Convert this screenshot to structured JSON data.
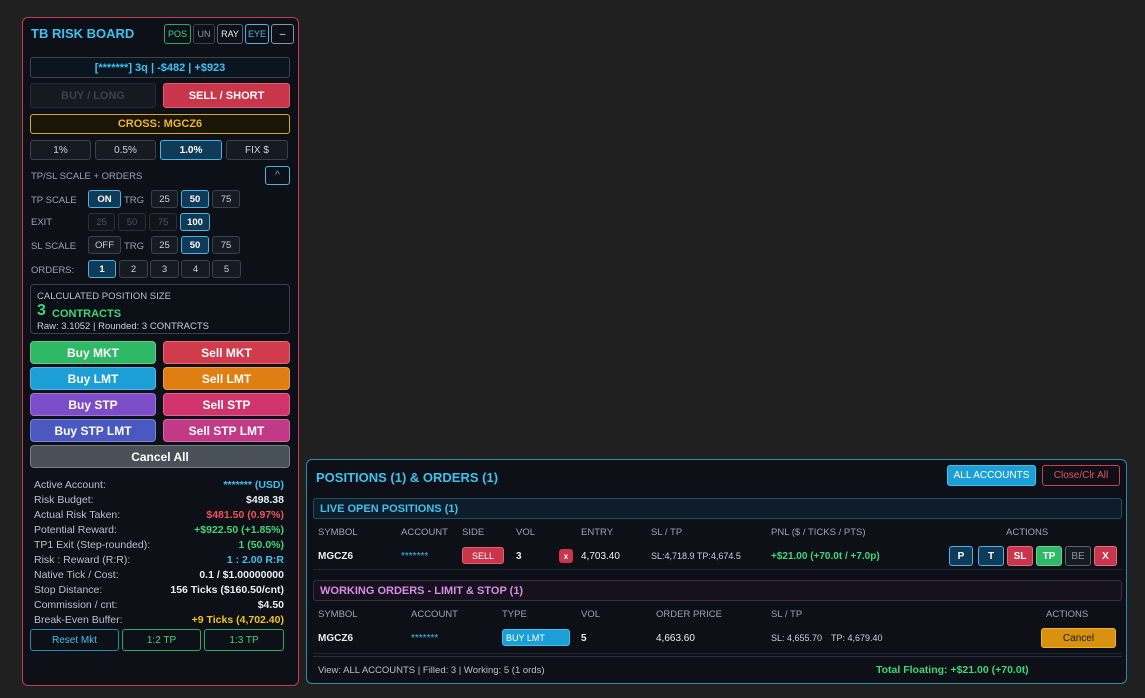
{
  "risk_board": {
    "title": "TB RISK BOARD",
    "toggles": [
      "POS",
      "UN",
      "RAY",
      "EYE",
      "–"
    ],
    "summary": "[*******] 3q | -$482 | +$923",
    "buy_long": "BUY / LONG",
    "sell_short": "SELL / SHORT",
    "cross": "CROSS: MGCZ6",
    "risk_options": [
      "1%",
      "0.5%",
      "1.0%",
      "FIX $"
    ],
    "scale_section": "TP/SL SCALE + ORDERS",
    "collapse": "^",
    "tp_scale": {
      "label": "TP SCALE",
      "state": "ON",
      "trg": "TRG",
      "values": [
        "25",
        "50",
        "75"
      ]
    },
    "exit": {
      "label": "EXIT",
      "values": [
        "25",
        "50",
        "75",
        "100"
      ]
    },
    "sl_scale": {
      "label": "SL SCALE",
      "state": "OFF",
      "trg": "TRG",
      "values": [
        "25",
        "50",
        "75"
      ]
    },
    "orders": {
      "label": "ORDERS:",
      "values": [
        "1",
        "2",
        "3",
        "4",
        "5"
      ]
    },
    "calc": {
      "title": "CALCULATED POSITION SIZE",
      "qty": "3",
      "unit": "CONTRACTS",
      "detail": "Raw: 3.1052 | Rounded: 3 CONTRACTS"
    },
    "buttons": {
      "buy_mkt": "Buy MKT",
      "sell_mkt": "Sell MKT",
      "buy_lmt": "Buy LMT",
      "sell_lmt": "Sell LMT",
      "buy_stp": "Buy STP",
      "sell_stp": "Sell STP",
      "buy_stp_lmt": "Buy STP LMT",
      "sell_stp_lmt": "Sell STP LMT",
      "cancel_all": "Cancel All"
    },
    "stats": [
      {
        "k": "Active Account:",
        "v": "******* (USD)",
        "c": "#3fc1f0"
      },
      {
        "k": "Risk Budget:",
        "v": "$498.38",
        "c": "#e6edf3"
      },
      {
        "k": "Actual Risk Taken:",
        "v": "$481.50 (0.97%)",
        "c": "#f0505a"
      },
      {
        "k": "Potential Reward:",
        "v": "+$922.50 (+1.85%)",
        "c": "#3fd67a"
      },
      {
        "k": "TP1 Exit (Step-rounded):",
        "v": "1 (50.0%)",
        "c": "#3fd67a"
      },
      {
        "k": "Risk : Reward (R:R):",
        "v": "1 : 2.00 R:R",
        "c": "#3fc1f0"
      },
      {
        "k": "Native Tick / Cost:",
        "v": "0.1 / $1.00000000",
        "c": "#e6edf3"
      },
      {
        "k": "Stop Distance:",
        "v": "156 Ticks ($160.50/cnt)",
        "c": "#e6edf3"
      },
      {
        "k": "Commission / cnt:",
        "v": "$4.50",
        "c": "#e6edf3"
      },
      {
        "k": "Break-Even Buffer:",
        "v": "+9 Ticks (4,702.40)",
        "c": "#f0c419"
      }
    ],
    "footer": [
      "Reset Mkt",
      "1:2 TP",
      "1:3 TP"
    ]
  },
  "positions": {
    "title": "POSITIONS (1) & ORDERS (1)",
    "all_accounts": "ALL ACCOUNTS",
    "close_all": "Close/Clr All",
    "live": {
      "header": "LIVE OPEN POSITIONS (1)",
      "columns": [
        "SYMBOL",
        "ACCOUNT",
        "SIDE",
        "VOL",
        "ENTRY",
        "SL / TP",
        "PNL ($ / TICKS / PTS)",
        "ACTIONS"
      ],
      "row": {
        "symbol": "MGCZ6",
        "account": "*******",
        "side": "SELL",
        "vol": "3",
        "x": "x",
        "entry": "4,703.40",
        "sltp": "SL:4,718.9 TP:4,674.5",
        "pnl": "+$21.00 (+70.0t / +7.0p)",
        "actions": [
          "P",
          "T",
          "SL",
          "TP",
          "BE",
          "X"
        ]
      }
    },
    "working": {
      "header": "WORKING ORDERS - LIMIT & STOP (1)",
      "columns": [
        "SYMBOL",
        "ACCOUNT",
        "TYPE",
        "VOL",
        "ORDER PRICE",
        "SL / TP",
        "ACTIONS"
      ],
      "row": {
        "symbol": "MGCZ6",
        "account": "*******",
        "type": "BUY LMT",
        "vol": "5",
        "price": "4,663.60",
        "sl": "SL: 4,655.70",
        "tp": "TP: 4,679.40",
        "cancel": "Cancel"
      }
    },
    "footer_left": "View: ALL ACCOUNTS | Filled: 3 | Working: 5 (1 ords)",
    "footer_right": "Total Floating: +$21.00 (+70.0t)"
  }
}
